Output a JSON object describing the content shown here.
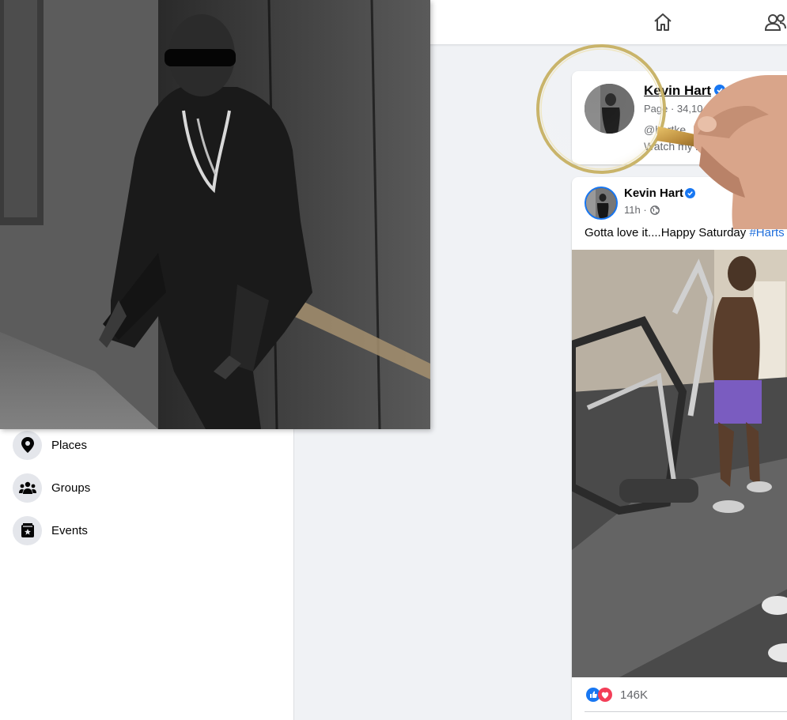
{
  "nav": {
    "home_icon": "home-icon",
    "friends_icon": "friends-icon"
  },
  "sidebar": {
    "items": [
      {
        "label": "Places",
        "icon": "location-pin-icon"
      },
      {
        "label": "Groups",
        "icon": "groups-icon"
      },
      {
        "label": "Events",
        "icon": "events-icon"
      }
    ]
  },
  "page_card": {
    "name": "Kevin Hart",
    "subtitle": "Page · 34,10",
    "handle": "@hartke",
    "description": "Watch my         Zero F"
  },
  "post": {
    "author": "Kevin Hart",
    "time": "11h ·",
    "text": "Gotta love it....Happy Saturday ",
    "hashtag": "#Harts",
    "reaction_count": "146K"
  },
  "colors": {
    "accent": "#1877f2",
    "link": "#216fdb",
    "like": "#1877f2",
    "love": "#f33e58"
  }
}
